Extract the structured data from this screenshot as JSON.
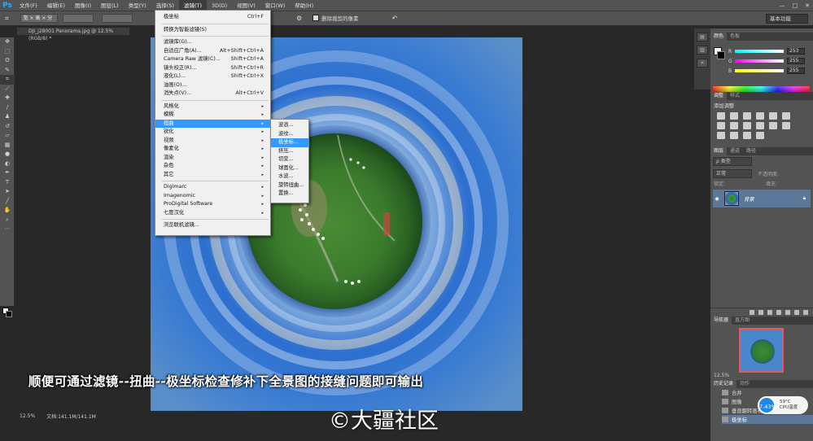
{
  "app": {
    "logo": "Ps",
    "menus": [
      "文件(F)",
      "编辑(E)",
      "图像(I)",
      "图层(L)",
      "类型(Y)",
      "选择(S)",
      "滤镜(T)",
      "3D(D)",
      "视图(V)",
      "窗口(W)",
      "帮助(H)"
    ],
    "active_menu_index": 6,
    "window_controls": [
      "—",
      "□",
      "✕"
    ]
  },
  "options_bar": {
    "ratio_label": "宽 × 高 × 分",
    "delete_cropped_label": "删除裁剪的像素",
    "workspace": "基本功能"
  },
  "document": {
    "tab_title": "DJI_j28001 Panorama.jpg @ 12.5%(RGB/8) *",
    "zoom": "12.5%",
    "doc_size": "文档:141.1M/141.1M"
  },
  "filter_menu": {
    "group1": [
      {
        "label": "极坐标",
        "shortcut": "Ctrl+F"
      }
    ],
    "group2": [
      {
        "label": "转换为智能滤镜(S)",
        "shortcut": ""
      }
    ],
    "group3": [
      {
        "label": "滤镜库(G)...",
        "shortcut": ""
      },
      {
        "label": "自适应广角(A)...",
        "shortcut": "Alt+Shift+Ctrl+A"
      },
      {
        "label": "Camera Raw 滤镜(C)...",
        "shortcut": "Shift+Ctrl+A"
      },
      {
        "label": "镜头校正(R)...",
        "shortcut": "Shift+Ctrl+R"
      },
      {
        "label": "液化(L)...",
        "shortcut": "Shift+Ctrl+X"
      },
      {
        "label": "油画(O)...",
        "shortcut": ""
      },
      {
        "label": "消失点(V)...",
        "shortcut": "Alt+Ctrl+V"
      }
    ],
    "group4": [
      {
        "label": "风格化",
        "arrow": "▸"
      },
      {
        "label": "模糊",
        "arrow": "▸"
      },
      {
        "label": "扭曲",
        "arrow": "▸"
      },
      {
        "label": "锐化",
        "arrow": "▸"
      },
      {
        "label": "视频",
        "arrow": "▸"
      },
      {
        "label": "像素化",
        "arrow": "▸"
      },
      {
        "label": "渲染",
        "arrow": "▸"
      },
      {
        "label": "杂色",
        "arrow": "▸"
      },
      {
        "label": "其它",
        "arrow": "▸"
      }
    ],
    "group5": [
      {
        "label": "Digimarc",
        "arrow": "▸"
      },
      {
        "label": "Imagenomic",
        "arrow": "▸"
      },
      {
        "label": "ProDigital Software",
        "arrow": "▸"
      },
      {
        "label": "七度汉化",
        "arrow": "▸"
      }
    ],
    "group6": [
      {
        "label": "浏览联机滤镜...",
        "shortcut": ""
      }
    ]
  },
  "distort_submenu": {
    "items": [
      "波浪...",
      "波纹...",
      "极坐标...",
      "挤压...",
      "切变...",
      "球面化...",
      "水波...",
      "旋转扭曲...",
      "置换..."
    ],
    "highlight_index": 2
  },
  "panels": {
    "color_tabs": [
      "颜色",
      "色板"
    ],
    "rgb": [
      {
        "label": "R",
        "value": "253",
        "gradient": "linear-gradient(to right,#00ffff,#ffffff)"
      },
      {
        "label": "G",
        "value": "255",
        "gradient": "linear-gradient(to right,#ff00ff,#ffffff)"
      },
      {
        "label": "B",
        "value": "255",
        "gradient": "linear-gradient(to right,#ffff00,#ffffff)"
      }
    ],
    "adjust_tabs": [
      "调整",
      "样式"
    ],
    "adjust_title": "添加调整",
    "layers_tabs": [
      "图层",
      "通道",
      "路径"
    ],
    "layers_filter": "ρ 类型",
    "blend_mode": "正常",
    "opacity_label": "不透明度:",
    "fill_label": "填充:",
    "lock_label": "锁定:",
    "layer_name": "背景",
    "navigator_tabs": [
      "导航器",
      "直方图"
    ],
    "nav_zoom": "12.5%",
    "history_tabs": [
      "历史记录",
      "动作"
    ],
    "history_items": [
      "合并",
      "图像",
      "垂直翻转画布",
      "极坐标"
    ],
    "cpu_percent": "7.43%",
    "cpu_temp": "59°C",
    "cpu_label": "CPU温度"
  },
  "overlay": {
    "caption": "顺便可通过滤镜--扭曲--极坐标检查修补下全景图的接缝问题即可输出",
    "watermark": "©大疆社区"
  }
}
